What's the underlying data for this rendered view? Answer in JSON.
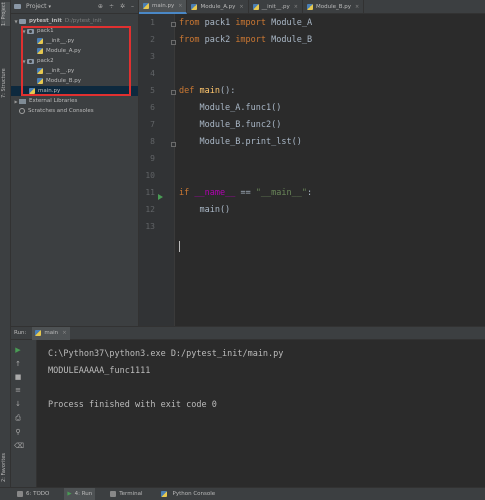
{
  "sidebar_tabs": {
    "project": "1: Project",
    "structure": "7: Structure",
    "favorites": "2: Favorites"
  },
  "project_panel": {
    "title": "Project",
    "tree": [
      {
        "label": "pytest_init",
        "hint": "D:/pytest_init",
        "kind": "folder",
        "level": 0
      },
      {
        "label": "pack1",
        "kind": "package",
        "level": 1
      },
      {
        "label": "__init__.py",
        "kind": "py",
        "level": 2
      },
      {
        "label": "Module_A.py",
        "kind": "py",
        "level": 2
      },
      {
        "label": "pack2",
        "kind": "package",
        "level": 1
      },
      {
        "label": "__init__.py",
        "kind": "py",
        "level": 2
      },
      {
        "label": "Module_B.py",
        "kind": "py",
        "level": 2
      },
      {
        "label": "main.py",
        "kind": "py",
        "level": 1,
        "selected": true
      },
      {
        "label": "External Libraries",
        "kind": "libs",
        "level": 0
      },
      {
        "label": "Scratches and Consoles",
        "kind": "scratch",
        "level": 0
      }
    ]
  },
  "editor_tabs": [
    {
      "label": "main.py",
      "active": true
    },
    {
      "label": "Module_A.py",
      "active": false
    },
    {
      "label": "__init__.py",
      "active": false
    },
    {
      "label": "Module_B.py",
      "active": false
    }
  ],
  "code_lines": [
    "1",
    "2",
    "3",
    "4",
    "5",
    "6",
    "7",
    "8",
    "9",
    "10",
    "11",
    "12",
    "13"
  ],
  "code": {
    "l1_kw1": "from",
    "l1_mod": " pack1 ",
    "l1_kw2": "import",
    "l1_name": " Module_A",
    "l2_kw1": "from",
    "l2_mod": " pack2 ",
    "l2_kw2": "import",
    "l2_name": " Module_B",
    "l5_kw": "def",
    "l5_fn": "main",
    "l5_rest": "():",
    "l6": "    Module_A.func1()",
    "l7": "    Module_B.func2()",
    "l8": "    Module_B.print_lst()",
    "l11_kw": "if",
    "l11_dunder": "__name__",
    "l11_op": " == ",
    "l11_str": "\"__main__\"",
    "l11_colon": ":",
    "l12": "    main()"
  },
  "run_panel": {
    "label": "Run:",
    "config": "main",
    "console": [
      "C:\\Python37\\python3.exe D:/pytest_init/main.py",
      "MODULEAAAAA_func1111",
      "",
      "Process finished with exit code 0"
    ]
  },
  "bottom_bar": [
    {
      "label": "6: TODO",
      "active": false
    },
    {
      "label": "4: Run",
      "active": true
    },
    {
      "label": "Terminal",
      "active": false
    },
    {
      "label": "Python Console",
      "active": false
    }
  ],
  "colors": {
    "background": "#2b2b2b",
    "panel": "#3c3f41",
    "keyword": "#cc7832",
    "function": "#ffc66d",
    "string": "#6a8759",
    "dunder": "#b200b2",
    "highlight_box": "#e03030"
  }
}
